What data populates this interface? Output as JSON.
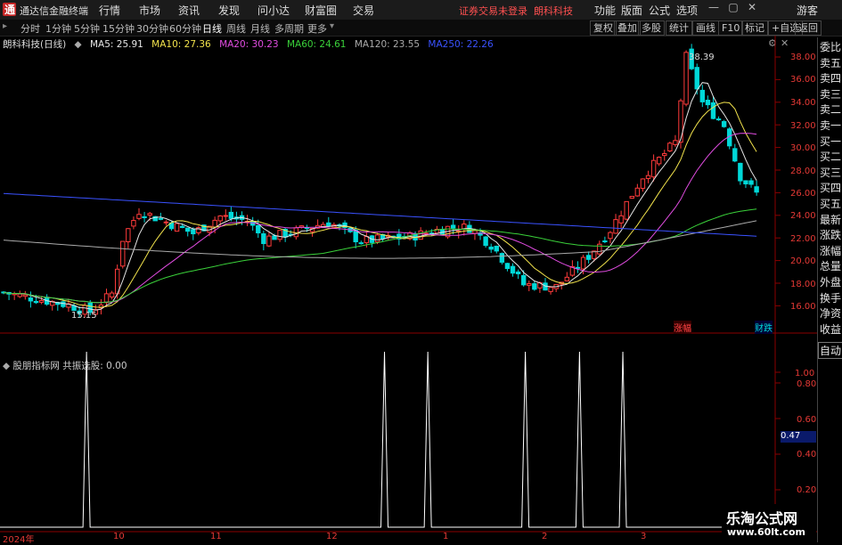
{
  "app": {
    "title": "通达信金融终端",
    "menu": [
      "行情",
      "市场",
      "资讯",
      "发现",
      "问小达",
      "财富圈",
      "交易"
    ],
    "warning": "证券交易未登录",
    "stock_link": "朗科科技",
    "menu_right": [
      "功能",
      "版面",
      "公式",
      "选项"
    ],
    "user": "游客"
  },
  "toolbar": {
    "periods": [
      "分时",
      "1分钟",
      "5分钟",
      "15分钟",
      "30分钟",
      "60分钟",
      "日线",
      "周线",
      "月线",
      "多周期",
      "更多"
    ],
    "active_period": "日线",
    "buttons": [
      "复权",
      "叠加",
      "多股",
      "统计",
      "画线",
      "F10",
      "标记",
      "+自选",
      "返回"
    ]
  },
  "indicators": {
    "stock_label": "朗科科技(日线)",
    "ma": [
      {
        "label": "MA5: 25.91",
        "color": "#e6e6e6"
      },
      {
        "label": "MA10: 27.36",
        "color": "#f2e34c"
      },
      {
        "label": "MA20: 30.23",
        "color": "#e04ce0"
      },
      {
        "label": "MA60: 24.61",
        "color": "#3ad13a"
      },
      {
        "label": "MA120: 23.55",
        "color": "#aaaaaa"
      },
      {
        "label": "MA250: 22.26",
        "color": "#3a52ff"
      }
    ]
  },
  "price_axis": [
    "38.00",
    "36.00",
    "34.00",
    "32.00",
    "30.00",
    "28.00",
    "26.00",
    "24.00",
    "22.00",
    "20.00",
    "18.00",
    "16.00"
  ],
  "annotations": {
    "high": "38.39",
    "low": "15.15",
    "tag_left": "涨幅",
    "tag_right": "财跌"
  },
  "oscillator": {
    "title": "股朋指标网 共振选股: 0.00",
    "axis": [
      "1.00",
      "0.80",
      "0.60",
      "0.47",
      "0.40",
      "0.20"
    ],
    "current": "0.47",
    "auto_label": "自动"
  },
  "date_axis": [
    "2024年",
    "10",
    "11",
    "12",
    "1",
    "2",
    "3"
  ],
  "side_panel": [
    "委比",
    "卖五",
    "卖四",
    "卖三",
    "卖二",
    "卖一",
    "买一",
    "买二",
    "买三",
    "买四",
    "买五",
    "最新",
    "涨跌",
    "涨幅",
    "总量",
    "外盘",
    "换手",
    "净资",
    "收益"
  ],
  "watermark": {
    "title": "乐淘公式网",
    "url": "www.60lt.com"
  },
  "colors": {
    "up": "#ff3b3b",
    "down": "#00d8d8",
    "axis": "#8b0000"
  },
  "chart_data": {
    "type": "line",
    "title": "朗科科技(日线)",
    "series": [
      {
        "name": "共振选股",
        "signal_days_index": [
          14,
          69,
          77,
          95,
          105,
          113
        ]
      }
    ]
  }
}
